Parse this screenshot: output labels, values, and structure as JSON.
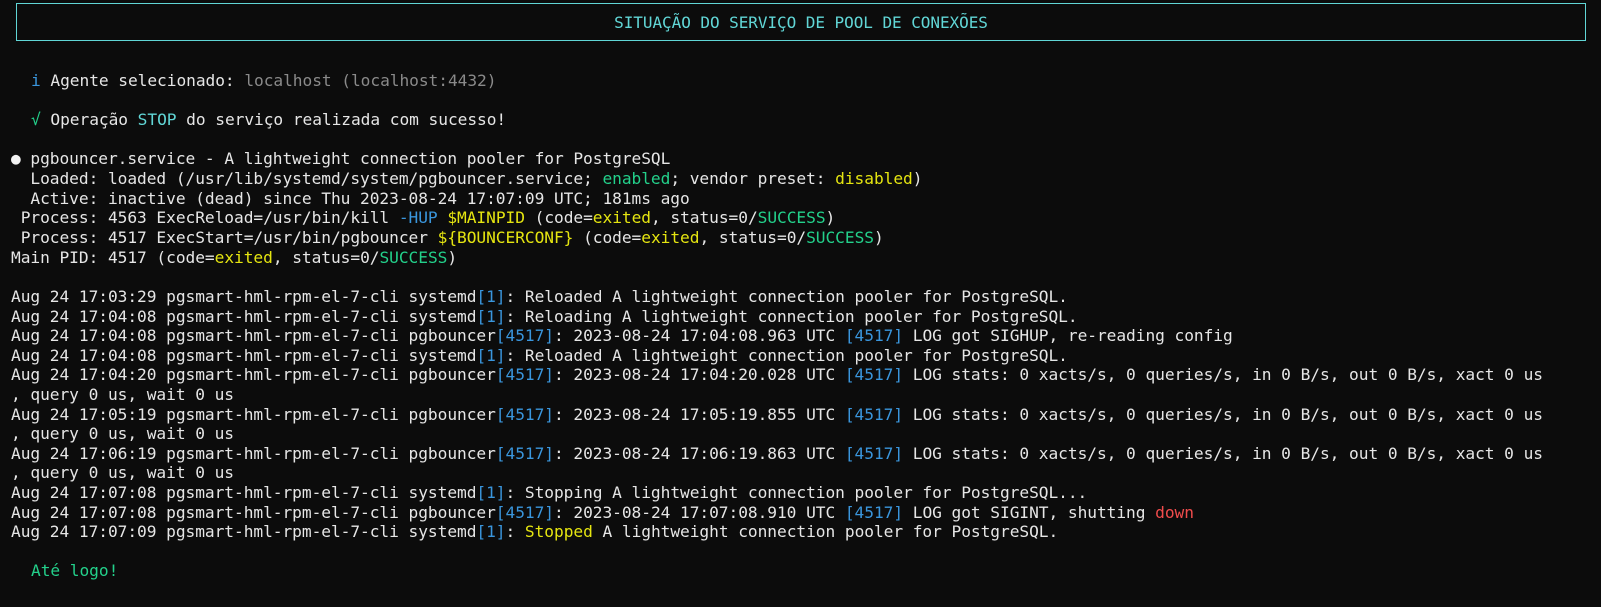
{
  "title": "SITUAÇÃO DO SERVIÇO DE POOL DE CONEXÕES",
  "agent": {
    "icon": "i",
    "label": "Agente selecionado: ",
    "value": "localhost (localhost:4432)"
  },
  "operation": {
    "icon": "√",
    "pre": "Operação ",
    "op": "STOP",
    "post": " do serviço realizada com sucesso!"
  },
  "status": {
    "bullet": "●",
    "header": " pgbouncer.service - A lightweight connection pooler for PostgreSQL",
    "loaded": {
      "a": "  Loaded: loaded (/usr/lib/systemd/system/pgbouncer.service; ",
      "enabled": "enabled",
      "b": "; vendor preset: ",
      "disabled": "disabled",
      "c": ")"
    },
    "active": "  Active: inactive (dead) since Thu 2023-08-24 17:07:09 UTC; 181ms ago",
    "process1": {
      "a": " Process: 4563 ExecReload=/usr/bin/kill ",
      "hup": "-HUP",
      "sp": " ",
      "pid": "$MAINPID",
      "b": " (code=",
      "exited": "exited",
      "c": ", status=0/",
      "success": "SUCCESS",
      "d": ")"
    },
    "process2": {
      "a": " Process: 4517 ExecStart=/usr/bin/pgbouncer ",
      "conf": "${BOUNCERCONF}",
      "b": " (code=",
      "exited": "exited",
      "c": ", status=0/",
      "success": "SUCCESS",
      "d": ")"
    },
    "mainpid": {
      "a": "Main PID: 4517 (code=",
      "exited": "exited",
      "b": ", status=0/",
      "success": "SUCCESS",
      "c": ")"
    }
  },
  "logs": [
    {
      "ts": "Aug 24 17:03:29 pgsmart-hml-rpm-el-7-cli ",
      "src": "systemd",
      "pid": "[1]",
      "msg": ": Reloaded A lightweight connection pooler for PostgreSQL."
    },
    {
      "ts": "Aug 24 17:04:08 pgsmart-hml-rpm-el-7-cli ",
      "src": "systemd",
      "pid": "[1]",
      "msg": ": Reloading A lightweight connection pooler for PostgreSQL."
    },
    {
      "ts": "Aug 24 17:04:08 pgsmart-hml-rpm-el-7-cli ",
      "src": "pgbouncer",
      "pid": "[4517]",
      "msg": ": 2023-08-24 17:04:08.963 UTC ",
      "pid2": "[4517]",
      "msg2": " LOG got SIGHUP, re-reading config"
    },
    {
      "ts": "Aug 24 17:04:08 pgsmart-hml-rpm-el-7-cli ",
      "src": "systemd",
      "pid": "[1]",
      "msg": ": Reloaded A lightweight connection pooler for PostgreSQL."
    },
    {
      "ts": "Aug 24 17:04:20 pgsmart-hml-rpm-el-7-cli ",
      "src": "pgbouncer",
      "pid": "[4517]",
      "msg": ": 2023-08-24 17:04:20.028 UTC ",
      "pid2": "[4517]",
      "msg2": " LOG stats: 0 xacts/s, 0 queries/s, in 0 B/s, out 0 B/s, xact 0 us",
      "cont": ", query 0 us, wait 0 us"
    },
    {
      "ts": "Aug 24 17:05:19 pgsmart-hml-rpm-el-7-cli ",
      "src": "pgbouncer",
      "pid": "[4517]",
      "msg": ": 2023-08-24 17:05:19.855 UTC ",
      "pid2": "[4517]",
      "msg2": " LOG stats: 0 xacts/s, 0 queries/s, in 0 B/s, out 0 B/s, xact 0 us",
      "cont": ", query 0 us, wait 0 us"
    },
    {
      "ts": "Aug 24 17:06:19 pgsmart-hml-rpm-el-7-cli ",
      "src": "pgbouncer",
      "pid": "[4517]",
      "msg": ": 2023-08-24 17:06:19.863 UTC ",
      "pid2": "[4517]",
      "msg2": " LOG stats: 0 xacts/s, 0 queries/s, in 0 B/s, out 0 B/s, xact 0 us",
      "cont": ", query 0 us, wait 0 us"
    },
    {
      "ts": "Aug 24 17:07:08 pgsmart-hml-rpm-el-7-cli ",
      "src": "systemd",
      "pid": "[1]",
      "msg": ": Stopping A lightweight connection pooler for PostgreSQL..."
    },
    {
      "ts": "Aug 24 17:07:08 pgsmart-hml-rpm-el-7-cli ",
      "src": "pgbouncer",
      "pid": "[4517]",
      "msg": ": 2023-08-24 17:07:08.910 UTC ",
      "pid2": "[4517]",
      "msg2": " LOG got SIGINT, shutting ",
      "down": "down"
    },
    {
      "ts": "Aug 24 17:07:09 pgsmart-hml-rpm-el-7-cli ",
      "src": "systemd",
      "pid": "[1]",
      "msg": ": ",
      "stopped": "Stopped",
      "msg3": " A lightweight connection pooler for PostgreSQL."
    }
  ],
  "farewell": "Até logo!",
  "colors": {
    "background": "#0c0c0c",
    "text": "#e6e6e6",
    "cyan": "#3a96dd",
    "teal": "#61d6d6",
    "green": "#23d18b",
    "yellow": "#e5e510",
    "gray": "#8a8a8a",
    "red": "#f14c4c"
  }
}
